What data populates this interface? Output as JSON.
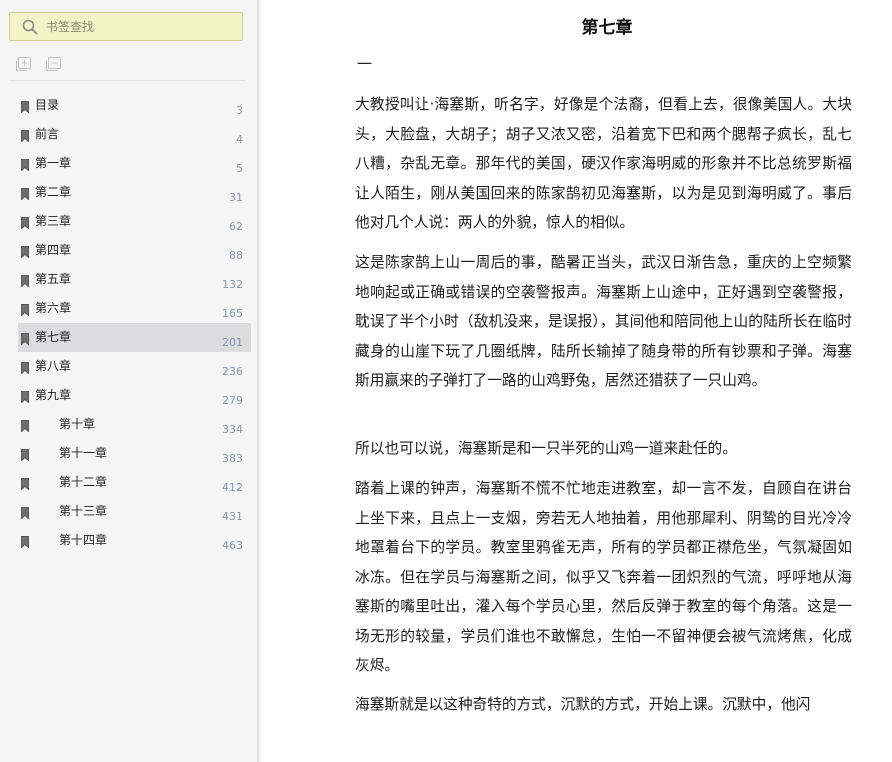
{
  "sidebar": {
    "search": {
      "placeholder": "书签查找"
    },
    "tools": [
      {
        "icon": "expand-all-icon"
      },
      {
        "icon": "collapse-all-icon"
      }
    ],
    "toc": [
      {
        "label": "目录",
        "page": "3",
        "level": 1
      },
      {
        "label": "前言",
        "page": "4",
        "level": 1
      },
      {
        "label": "第一章",
        "page": "5",
        "level": 1
      },
      {
        "label": "第二章",
        "page": "31",
        "level": 1
      },
      {
        "label": "第三章",
        "page": "62",
        "level": 1
      },
      {
        "label": "第四章",
        "page": "88",
        "level": 1
      },
      {
        "label": "第五章",
        "page": "132",
        "level": 1
      },
      {
        "label": "第六章",
        "page": "165",
        "level": 1
      },
      {
        "label": "第七章",
        "page": "201",
        "level": 1,
        "active": true
      },
      {
        "label": "第八章",
        "page": "236",
        "level": 1
      },
      {
        "label": "第九章",
        "page": "279",
        "level": 1
      },
      {
        "label": "第十章",
        "page": "334",
        "level": 2
      },
      {
        "label": "第十一章",
        "page": "383",
        "level": 2
      },
      {
        "label": "第十二章",
        "page": "412",
        "level": 2
      },
      {
        "label": "第十三章",
        "page": "431",
        "level": 2
      },
      {
        "label": "第十四章",
        "page": "463",
        "level": 2
      }
    ]
  },
  "document": {
    "chapter_title": "第七章",
    "section_mark": "一",
    "paragraphs": [
      "大教授叫让·海塞斯，听名字，好像是个法裔，但看上去，很像美国人。大块头，大脸盘，大胡子；胡子又浓又密，沿着宽下巴和两个腮帮子疯长，乱七八糟，杂乱无章。那年代的美国，硬汉作家海明威的形象并不比总统罗斯福让人陌生，刚从美国回来的陈家鹄初见海塞斯，以为是见到海明威了。事后他对几个人说：两人的外貌，惊人的相似。",
      "这是陈家鹄上山一周后的事，酷暑正当头，武汉日渐告急，重庆的上空频繁地响起或正确或错误的空袭警报声。海塞斯上山途中，正好遇到空袭警报，耽误了半个小时（敌机没来，是误报），其间他和陪同他上山的陆所长在临时藏身的山崖下玩了几圈纸牌，陆所长输掉了随身带的所有钞票和子弹。海塞斯用赢来的子弹打了一路的山鸡野兔，居然还猎获了一只山鸡。",
      "所以也可以说，海塞斯是和一只半死的山鸡一道来赴任的。",
      "踏着上课的钟声，海塞斯不慌不忙地走进教室，却一言不发，自顾自在讲台上坐下来，且点上一支烟，旁若无人地抽着，用他那犀利、阴鸷的目光冷冷地罩着台下的学员。教室里鸦雀无声，所有的学员都正襟危坐，气氛凝固如冰冻。但在学员与海塞斯之间，似乎又飞奔着一团炽烈的气流，呼呼地从海塞斯的嘴里吐出，灌入每个学员心里，然后反弹于教室的每个角落。这是一场无形的较量，学员们谁也不敢懈怠，生怕一不留神便会被气流烤焦，化成灰烬。",
      "海塞斯就是以这种奇特的方式，沉默的方式，开始上课。沉默中，他闪"
    ]
  },
  "colors": {
    "search_bg": "#f3f3c7",
    "active_row": "#dcdcde",
    "page_number": "#8895a8"
  }
}
